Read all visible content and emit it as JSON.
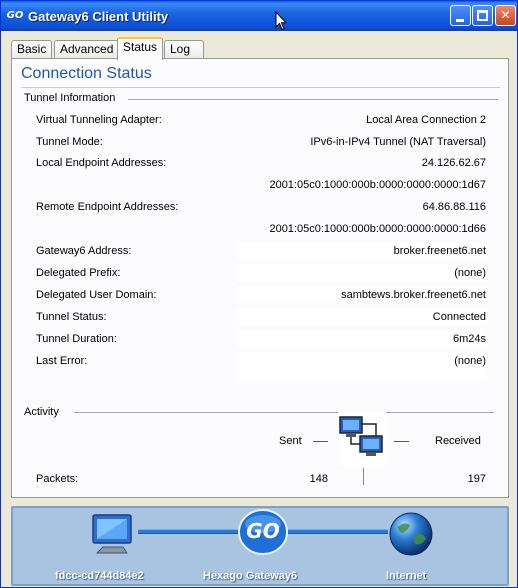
{
  "window": {
    "title": "Gateway6 Client Utility",
    "logo_text": "GO",
    "minimize_label": "",
    "maximize_label": "",
    "close_label": "✕"
  },
  "tabs": [
    {
      "label": "Basic",
      "active": false
    },
    {
      "label": "Advanced",
      "active": false
    },
    {
      "label": "Status",
      "active": true
    },
    {
      "label": "Log",
      "active": false
    }
  ],
  "panel": {
    "title": "Connection Status",
    "tunnel_group": "Tunnel Information",
    "activity_group": "Activity"
  },
  "tunnel": {
    "adapter_label": "Virtual Tunneling Adapter:",
    "adapter_value": "Local Area Connection 2",
    "mode_label": "Tunnel Mode:",
    "mode_value": "IPv6-in-IPv4 Tunnel (NAT Traversal)",
    "local_label": "Local Endpoint Addresses:",
    "local_v4": "24.126.62.67",
    "local_v6": "2001:05c0:1000:000b:0000:0000:0000:1d67",
    "remote_label": "Remote Endpoint Addresses:",
    "remote_v4": "64.86.88.116",
    "remote_v6": "2001:05c0:1000:000b:0000:0000:0000:1d66",
    "gateway_label": "Gateway6 Address:",
    "gateway_value": "broker.freenet6.net",
    "prefix_label": "Delegated Prefix:",
    "prefix_value": "(none)",
    "domain_label": "Delegated User Domain:",
    "domain_value": "sambtews.broker.freenet6.net",
    "status_label": "Tunnel Status:",
    "status_value": "Connected",
    "duration_label": "Tunnel Duration:",
    "duration_value": "6m24s",
    "error_label": "Last Error:",
    "error_value": "(none)"
  },
  "activity": {
    "sent_label": "Sent",
    "received_label": "Received",
    "packets_label": "Packets:",
    "packets_sent": "148",
    "packets_received": "197"
  },
  "topology": {
    "client_label": "fdcc-cd744d84e2",
    "gateway_label": "Hexago Gateway6",
    "gateway_logo": "GO",
    "internet_label": "Internet"
  },
  "icons": {
    "computer": "computer-icon",
    "gateway": "gateway6-logo-icon",
    "internet": "globe-icon",
    "activity": "network-activity-icon"
  },
  "colors": {
    "titlebar": "#0b4fd6",
    "panel_title": "#2155b0",
    "bottom_bg": "#a8c4e0",
    "connector": "#2b7ad0"
  }
}
